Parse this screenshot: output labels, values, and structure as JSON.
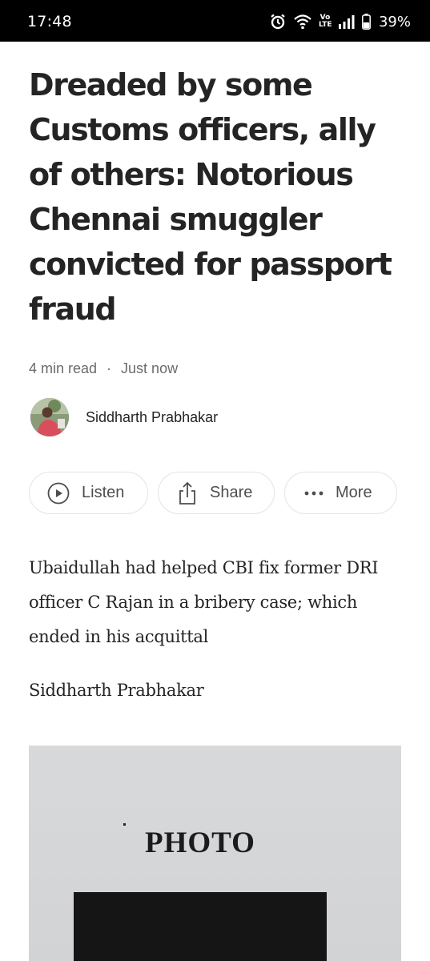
{
  "status_bar": {
    "time": "17:48",
    "network": "Vo LTE",
    "battery": "39%",
    "icons": [
      "alarm-icon",
      "wifi-icon",
      "volte-icon",
      "signal-icon",
      "battery-icon"
    ]
  },
  "article": {
    "title": "Dreaded by some Customs officers, ally of others: Notorious Chennai smuggler convicted for passport fraud",
    "read_time": "4 min read",
    "separator": "·",
    "posted": "Just now",
    "author": "Siddharth Prabhakar",
    "subtitle": "Ubaidullah had helped CBI fix former DRI officer C Rajan in a bribery case; which ended in his acquittal",
    "byline": "Siddharth Prabhakar"
  },
  "actions": {
    "listen": "Listen",
    "share": "Share",
    "more": "More"
  },
  "image": {
    "label": "PHOTO"
  },
  "colors": {
    "text": "#242424",
    "muted": "#6b6b6b",
    "border": "#e4e4e4",
    "status_bar": "#000000"
  }
}
